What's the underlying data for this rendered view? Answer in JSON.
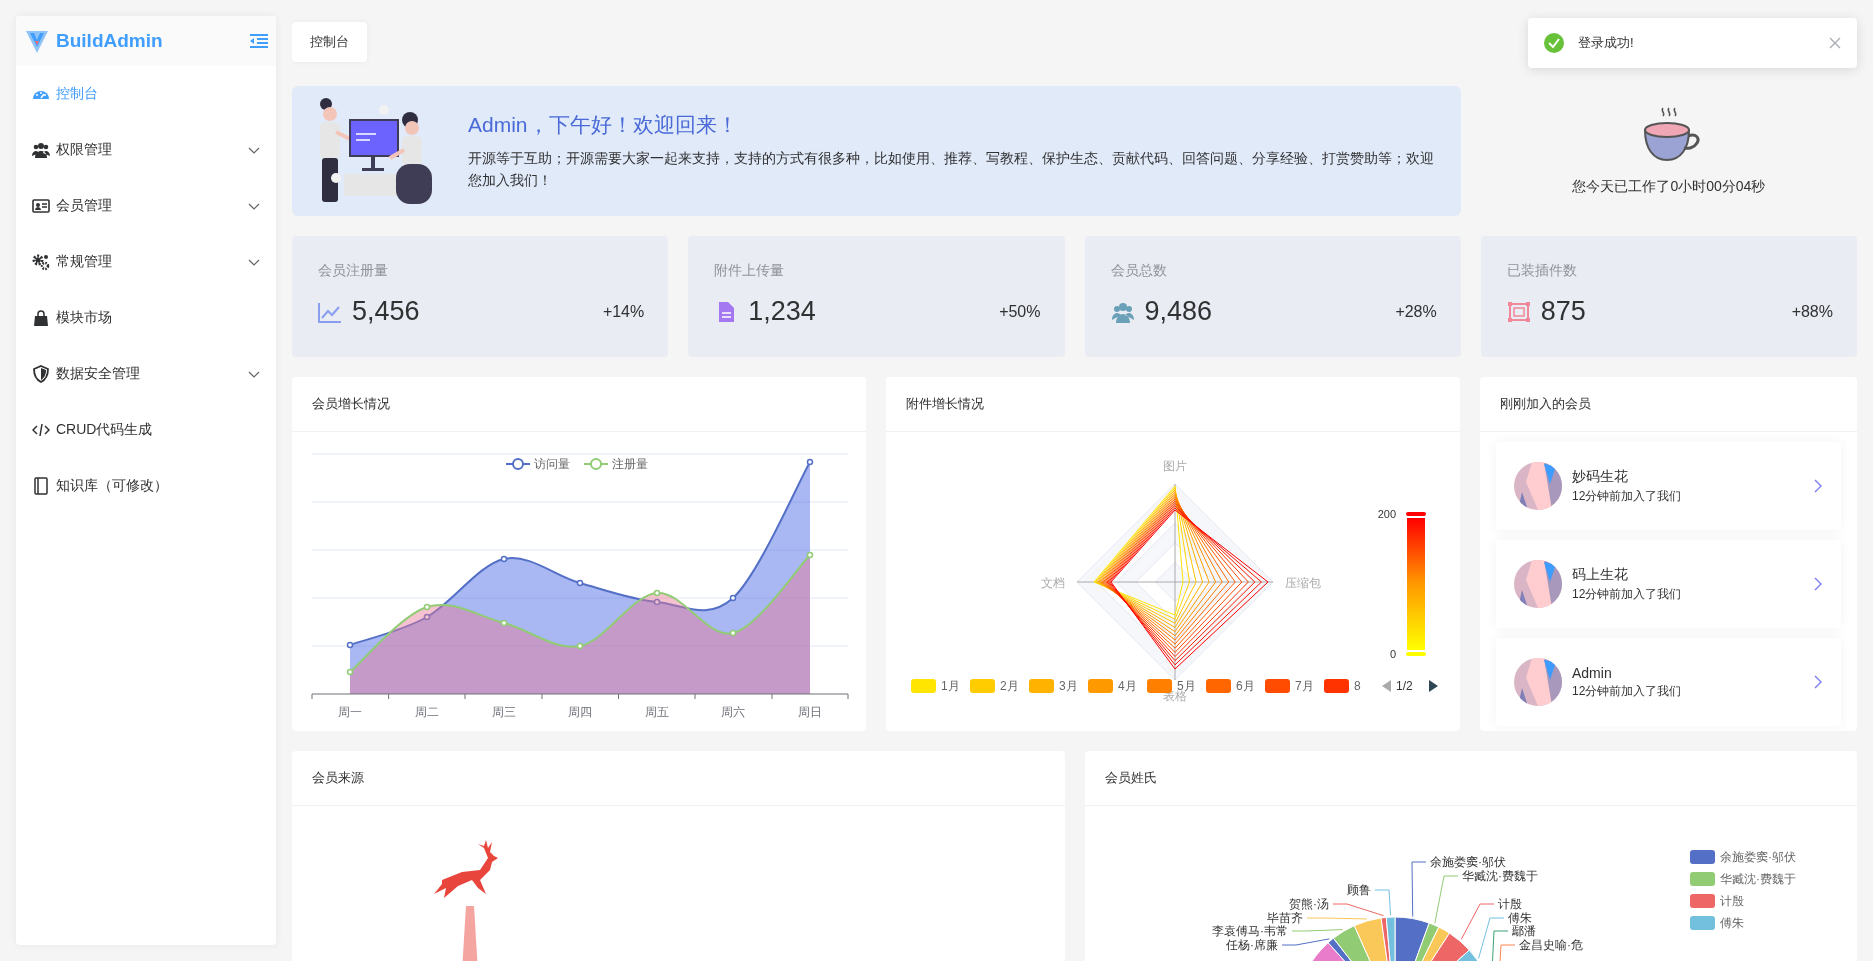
{
  "sidebar": {
    "logo": "BuildAdmin",
    "items": [
      {
        "label": "控制台",
        "selected": true,
        "has_submenu": false
      },
      {
        "label": "权限管理",
        "selected": false,
        "has_submenu": true
      },
      {
        "label": "会员管理",
        "selected": false,
        "has_submenu": true
      },
      {
        "label": "常规管理",
        "selected": false,
        "has_submenu": true
      },
      {
        "label": "模块市场",
        "selected": false,
        "has_submenu": false
      },
      {
        "label": "数据安全管理",
        "selected": false,
        "has_submenu": true
      },
      {
        "label": "CRUD代码生成",
        "selected": false,
        "has_submenu": false
      },
      {
        "label": "知识库（可修改）",
        "selected": false,
        "has_submenu": false
      }
    ]
  },
  "tabs": [
    {
      "label": "控制台",
      "selected": true
    }
  ],
  "toast": {
    "kind": "success",
    "message": "登录成功!"
  },
  "welcome": {
    "title": "Admin，下午好！欢迎回来！",
    "text": "开源等于互助；开源需要大家一起来支持，支持的方式有很多种，比如使用、推荐、写教程、保护生态、贡献代码、回答问题、分享经验、打赏赞助等；欢迎您加入我们！"
  },
  "work_time": "您今天已工作了0小时00分04秒",
  "stats": [
    {
      "label": "会员注册量",
      "value": "5,456",
      "change": "+14%"
    },
    {
      "label": "附件上传量",
      "value": "1,234",
      "change": "+50%"
    },
    {
      "label": "会员总数",
      "value": "9,486",
      "change": "+28%"
    },
    {
      "label": "已装插件数",
      "value": "875",
      "change": "+88%"
    }
  ],
  "member_growth": {
    "title": "会员增长情况",
    "legend": [
      {
        "name": "访问量",
        "color": "#5470c6"
      },
      {
        "name": "注册量",
        "color": "#91cc75"
      }
    ],
    "categories": [
      "周一",
      "周二",
      "周三",
      "周四",
      "周五",
      "周六",
      "周日"
    ]
  },
  "attachment_growth": {
    "title": "附件增长情况",
    "axes": [
      "图片",
      "压缩包",
      "表格",
      "文档"
    ],
    "scale_max": "200",
    "scale_min": "0",
    "legend": [
      {
        "name": "1月",
        "color": "#ffe500"
      },
      {
        "name": "2月",
        "color": "#ffcc00"
      },
      {
        "name": "3月",
        "color": "#ffb300"
      },
      {
        "name": "4月",
        "color": "#ff9900"
      },
      {
        "name": "5月",
        "color": "#ff8000"
      },
      {
        "name": "6月",
        "color": "#ff6600"
      },
      {
        "name": "7月",
        "color": "#ff4c00"
      },
      {
        "name": "8",
        "color": "#ff3300"
      }
    ],
    "page": "1/2"
  },
  "new_members": {
    "title": "刚刚加入的会员",
    "members": [
      {
        "name": "妙码生花",
        "joined": "12分钟前加入了我们"
      },
      {
        "name": "码上生花",
        "joined": "12分钟前加入了我们"
      },
      {
        "name": "Admin",
        "joined": "12分钟前加入了我们"
      }
    ]
  },
  "member_source": {
    "title": "会员来源"
  },
  "member_surnames": {
    "title": "会员姓氏",
    "labels": [
      "余施娄窦·邬伏",
      "华臧沈·费魏于",
      "计殷",
      "傅朱",
      "鄢潘",
      "金昌史喻·危",
      "顾鲁",
      "贺熊·汤",
      "毕苗齐",
      "李袁傅马·韦常",
      "任杨·席廉"
    ],
    "legend": [
      {
        "name": "余施娄窦·邬伏",
        "color": "#5470c6"
      },
      {
        "name": "华臧沈·费魏于",
        "color": "#91cc75"
      },
      {
        "name": "计殷",
        "color": "#ee6666"
      },
      {
        "name": "傅朱",
        "color": "#73c0de"
      }
    ]
  }
}
